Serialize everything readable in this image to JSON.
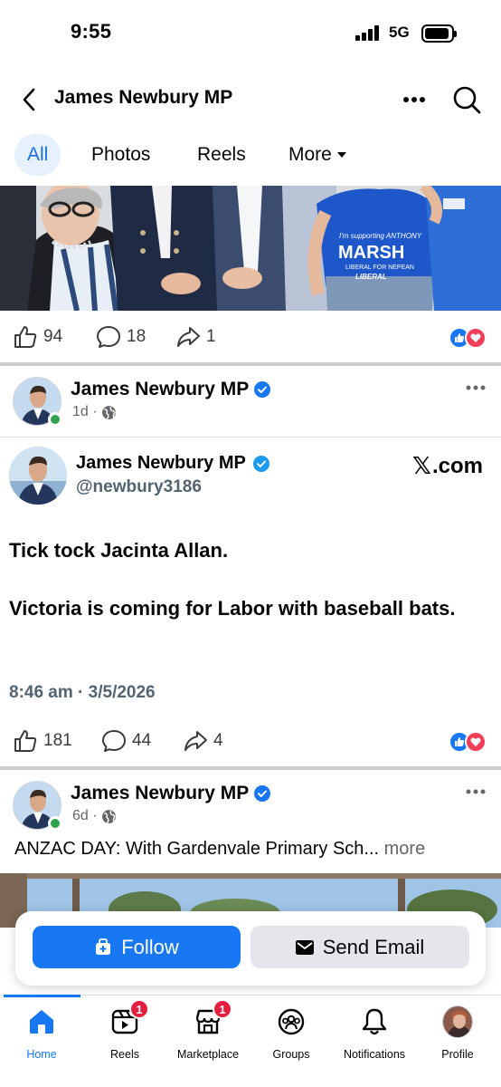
{
  "status_bar": {
    "time": "9:55",
    "network": "5G",
    "icons": [
      "signal-icon",
      "battery-icon"
    ]
  },
  "header": {
    "title": "James Newbury MP",
    "icons": [
      "back-chevron-icon",
      "more-dots-icon",
      "search-icon"
    ]
  },
  "tabs": [
    {
      "label": "All",
      "active": true
    },
    {
      "label": "Photos",
      "active": false
    },
    {
      "label": "Reels",
      "active": false
    },
    {
      "label": "More",
      "active": false
    }
  ],
  "photo_strip": {
    "shirt_text_1": "I'm supporting ANTHONY",
    "shirt_text_2": "MARSH",
    "shirt_text_3": "LIBERAL FOR NEPEAN",
    "shirt_text_4": "LIBERAL"
  },
  "post_1_reactions": {
    "likes": "94",
    "comments": "18",
    "shares": "1"
  },
  "post_2": {
    "author": "James Newbury MP",
    "meta": "1d ·",
    "embed": {
      "name": "James Newbury MP",
      "handle": "@newbury3186",
      "source_x": "𝕏",
      "source_com": ".com",
      "text_1": "Tick tock Jacinta Allan.",
      "text_2": "Victoria is coming for Labor with baseball bats.",
      "timestamp": "8:46 am · 3/5/2026"
    },
    "reactions": {
      "likes": "181",
      "comments": "44",
      "shares": "4"
    }
  },
  "post_3": {
    "author": "James Newbury MP",
    "meta": "6d ·",
    "caption": "ANZAC DAY: With Gardenvale Primary Sch...",
    "caption_more": "more"
  },
  "actions": {
    "follow_label": "Follow",
    "email_label": "Send Email"
  },
  "bottom_nav": [
    {
      "label": "Home",
      "icon": "home-icon",
      "active": true,
      "badge": ""
    },
    {
      "label": "Reels",
      "icon": "reels-icon",
      "active": false,
      "badge": "1"
    },
    {
      "label": "Marketplace",
      "icon": "marketplace-icon",
      "active": false,
      "badge": "1"
    },
    {
      "label": "Groups",
      "icon": "groups-icon",
      "active": false,
      "badge": ""
    },
    {
      "label": "Notifications",
      "icon": "bell-icon",
      "active": false,
      "badge": ""
    },
    {
      "label": "Profile",
      "icon": "profile-avatar",
      "active": false,
      "badge": ""
    }
  ],
  "colors": {
    "accent": "#1877f2",
    "tab_active_bg": "#e7f0fd",
    "badge": "#e41e3f",
    "love": "#f33e58",
    "online": "#31a24c"
  }
}
